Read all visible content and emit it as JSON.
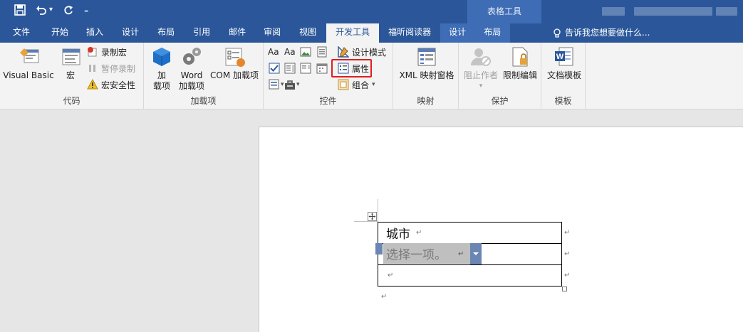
{
  "titlebar": {
    "context_group": "表格工具",
    "qat": {
      "save_icon": "save-icon",
      "undo_icon": "undo-icon",
      "undo_dropdown": "▾",
      "redo_icon": "redo-icon",
      "customize": "₌"
    }
  },
  "tabs": [
    {
      "label": "文件"
    },
    {
      "label": "开始"
    },
    {
      "label": "插入"
    },
    {
      "label": "设计"
    },
    {
      "label": "布局"
    },
    {
      "label": "引用"
    },
    {
      "label": "邮件"
    },
    {
      "label": "审阅"
    },
    {
      "label": "视图"
    },
    {
      "label": "开发工具"
    },
    {
      "label": "福昕阅读器"
    },
    {
      "label": "设计"
    },
    {
      "label": "布局"
    }
  ],
  "tellme": "告诉我您想要做什么...",
  "ribbon": {
    "code": {
      "label": "代码",
      "visual_basic": "Visual Basic",
      "macros": "宏",
      "record_macro": "录制宏",
      "pause_recording": "暂停录制",
      "macro_security": "宏安全性"
    },
    "addins": {
      "label": "加载项",
      "addins_line1": "加",
      "addins_line2": "载项",
      "word_addins_line1": "Word",
      "word_addins_line2": "加载项",
      "com_addins": "COM 加载项"
    },
    "controls": {
      "label": "控件",
      "design_mode": "设计模式",
      "properties": "属性",
      "group": "组合"
    },
    "mapping": {
      "label": "映射",
      "xml_pane": "XML 映射窗格"
    },
    "protect": {
      "label": "保护",
      "block_authors": "阻止作者",
      "restrict_editing": "限制编辑"
    },
    "templates": {
      "label": "模板",
      "document_template": "文档模板"
    }
  },
  "document": {
    "row1_text": "城市",
    "dropdown_placeholder": "选择一项。",
    "paragraph_mark": "↵"
  },
  "colors": {
    "accent": "#2b579a",
    "highlight": "#e11d1d"
  }
}
